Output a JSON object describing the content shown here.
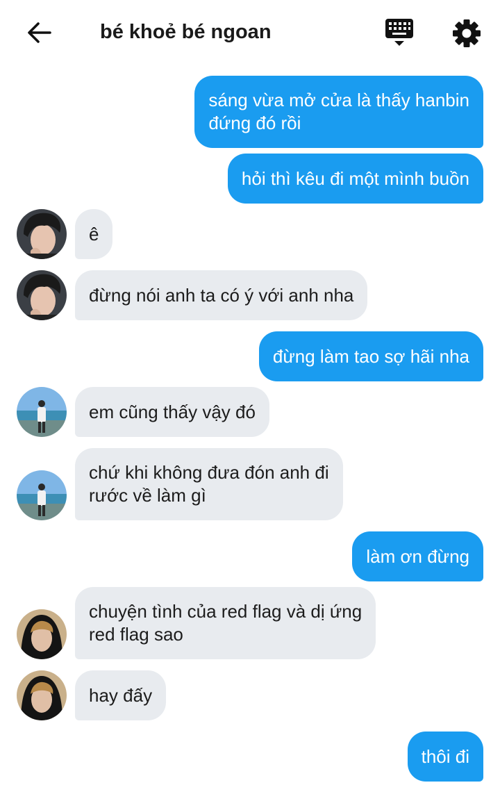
{
  "header": {
    "title": "bé khoẻ bé ngoan",
    "back_icon": "arrow-left-icon",
    "keyboard_icon": "keyboard-icon",
    "settings_icon": "gear-icon"
  },
  "colors": {
    "outgoing_bubble": "#1a9cf0",
    "incoming_bubble": "#e8ebef"
  },
  "messages": [
    {
      "direction": "out",
      "lines": [
        "sáng vừa mở cửa là thấy hanbin",
        "đứng đó rồi"
      ]
    },
    {
      "direction": "out",
      "lines": [
        "hỏi thì kêu đi một mình buồn"
      ]
    },
    {
      "direction": "in",
      "avatar": "avatar-dark-hair",
      "lines": [
        "ê"
      ]
    },
    {
      "direction": "in",
      "avatar": "avatar-dark-hair",
      "lines": [
        "đừng nói anh ta có ý với anh nha"
      ]
    },
    {
      "direction": "out",
      "lines": [
        "đừng làm tao sợ hãi nha"
      ]
    },
    {
      "direction": "in",
      "avatar": "avatar-beach",
      "lines": [
        "em cũng thấy vậy đó"
      ]
    },
    {
      "direction": "in",
      "avatar": "avatar-beach",
      "lines": [
        "chứ khi không đưa đón anh đi",
        "rước về làm gì"
      ]
    },
    {
      "direction": "out",
      "lines": [
        "làm ơn đừng"
      ]
    },
    {
      "direction": "in",
      "avatar": "avatar-hood",
      "lines": [
        "chuyện tình của red flag và dị ứng",
        "red flag sao"
      ]
    },
    {
      "direction": "in",
      "avatar": "avatar-hood",
      "lines": [
        "hay đấy"
      ]
    },
    {
      "direction": "out",
      "lines": [
        "thôi đi"
      ]
    }
  ]
}
